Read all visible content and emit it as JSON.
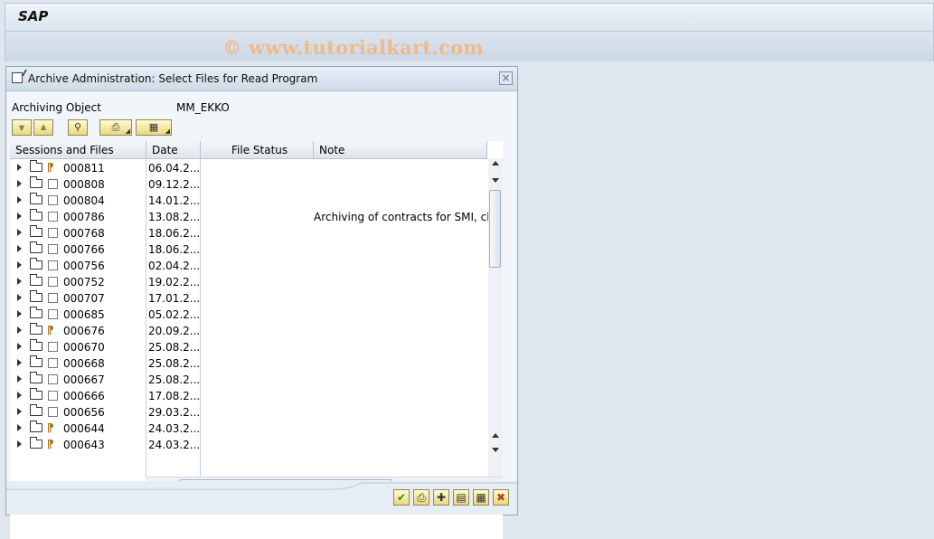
{
  "app": {
    "brand": "SAP",
    "watermark": "© www.tutorialkart.com"
  },
  "dialog": {
    "title": "Archive Administration: Select Files for Read Program",
    "close_label": "×",
    "field_label": "Archiving Object",
    "field_value": "MM_EKKO"
  },
  "toolbar_icons": [
    "expand-all-icon",
    "collapse-all-icon",
    "find-icon",
    "print-icon",
    "layout-icon"
  ],
  "grid": {
    "headers": [
      "Sessions and Files",
      "Date",
      "File Status",
      "Note"
    ],
    "rows": [
      {
        "session": "000811",
        "date": "06.04.2...",
        "archived": true,
        "note": ""
      },
      {
        "session": "000808",
        "date": "09.12.2...",
        "archived": false,
        "note": ""
      },
      {
        "session": "000804",
        "date": "14.01.2...",
        "archived": false,
        "note": ""
      },
      {
        "session": "000786",
        "date": "13.08.2...",
        "archived": false,
        "note": "Archiving of contracts for SMI, clea"
      },
      {
        "session": "000768",
        "date": "18.06.2...",
        "archived": false,
        "note": ""
      },
      {
        "session": "000766",
        "date": "18.06.2...",
        "archived": false,
        "note": ""
      },
      {
        "session": "000756",
        "date": "02.04.2...",
        "archived": false,
        "note": ""
      },
      {
        "session": "000752",
        "date": "19.02.2...",
        "archived": false,
        "note": ""
      },
      {
        "session": "000707",
        "date": "17.01.2...",
        "archived": false,
        "note": ""
      },
      {
        "session": "000685",
        "date": "05.02.2...",
        "archived": false,
        "note": ""
      },
      {
        "session": "000676",
        "date": "20.09.2...",
        "archived": true,
        "note": ""
      },
      {
        "session": "000670",
        "date": "25.08.2...",
        "archived": false,
        "note": ""
      },
      {
        "session": "000668",
        "date": "25.08.2...",
        "archived": false,
        "note": ""
      },
      {
        "session": "000667",
        "date": "25.08.2...",
        "archived": false,
        "note": ""
      },
      {
        "session": "000666",
        "date": "17.08.2...",
        "archived": false,
        "note": ""
      },
      {
        "session": "000656",
        "date": "29.03.2...",
        "archived": false,
        "note": ""
      },
      {
        "session": "000644",
        "date": "24.03.2...",
        "archived": true,
        "note": ""
      },
      {
        "session": "000643",
        "date": "24.03.2...",
        "archived": true,
        "note": ""
      }
    ]
  },
  "footer_buttons": [
    {
      "name": "continue-button",
      "glyph": "✔",
      "color": "#2e8b2e"
    },
    {
      "name": "print-button",
      "glyph": "⎙",
      "color": "#333"
    },
    {
      "name": "create-button",
      "glyph": "✚",
      "color": "#333"
    },
    {
      "name": "select-button",
      "glyph": "▤",
      "color": "#333"
    },
    {
      "name": "details-button",
      "glyph": "▦",
      "color": "#333"
    },
    {
      "name": "cancel-button",
      "glyph": "✖",
      "color": "#c0392b"
    }
  ]
}
